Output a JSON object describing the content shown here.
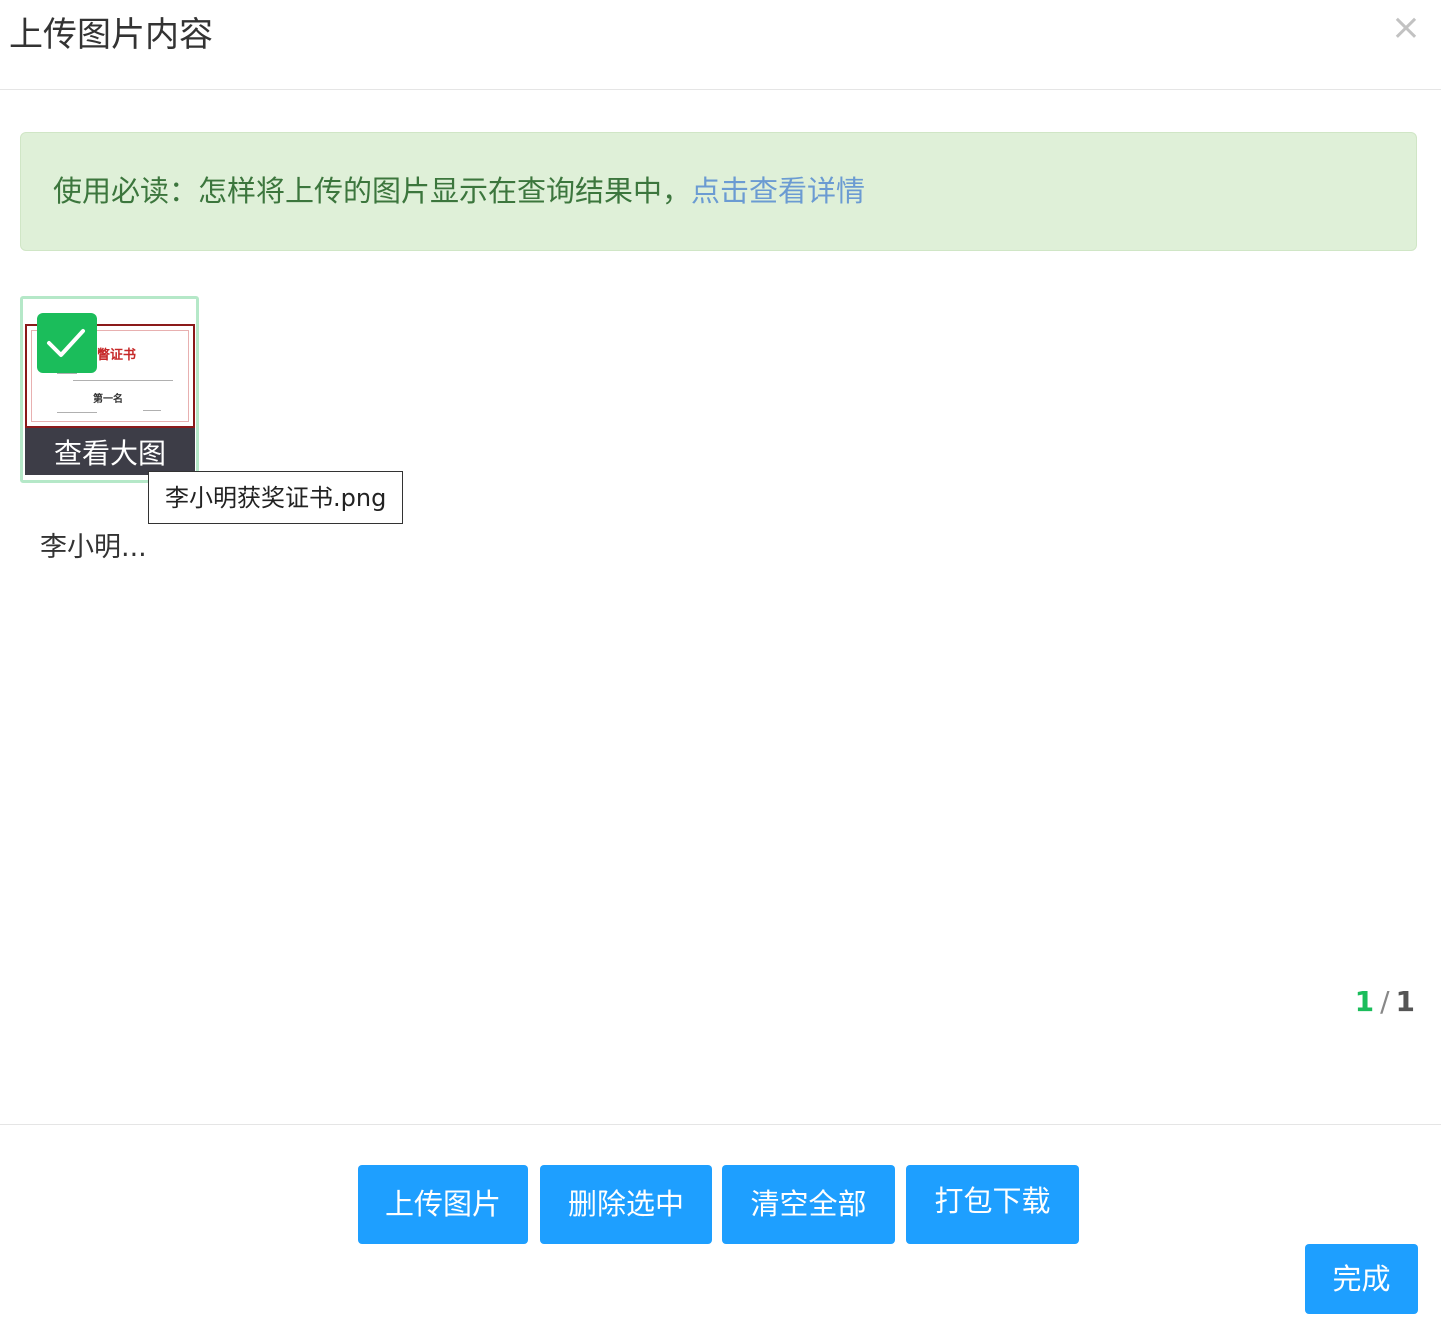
{
  "dialog": {
    "title": "上传图片内容",
    "close_label": "×"
  },
  "notice": {
    "text": "使用必读：怎样将上传的图片显示在查询结果中，",
    "link": "点击查看详情"
  },
  "images": [
    {
      "name_short": "李小明...",
      "name_full": "李小明获奖证书.png",
      "selected": true,
      "overlay_label": "查看大图",
      "preview": {
        "heading": "瞥证书",
        "award": "第一名"
      }
    }
  ],
  "pagination": {
    "current": "1",
    "separator": "/",
    "total": "1"
  },
  "actions": {
    "upload": "上传图片",
    "delete_selected": "删除选中",
    "clear_all": "清空全部",
    "download_zip": "打包下载",
    "done": "完成"
  },
  "colors": {
    "primary": "#1e9fff",
    "success": "#1bbd5b",
    "notice_bg": "#dff0d8",
    "notice_text": "#3c763d",
    "link": "#6b9bd2"
  }
}
